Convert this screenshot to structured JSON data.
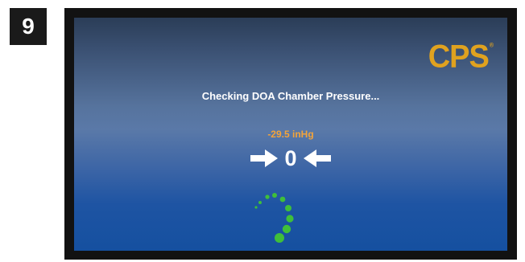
{
  "step": {
    "number": "9"
  },
  "brand": {
    "logo_text": "CPS",
    "trademark": "®",
    "color": "#e0a21f"
  },
  "screen": {
    "status_title": "Checking DOA Chamber Pressure...",
    "pressure_reading": "-29.5 inHg",
    "zero_value": "0",
    "left_icon": "arrow-right-icon",
    "right_icon": "arrow-left-icon",
    "loading_icon": "spinner-icon",
    "spinner_color": "#3fbf3a",
    "reading_color": "#f3a43a"
  }
}
